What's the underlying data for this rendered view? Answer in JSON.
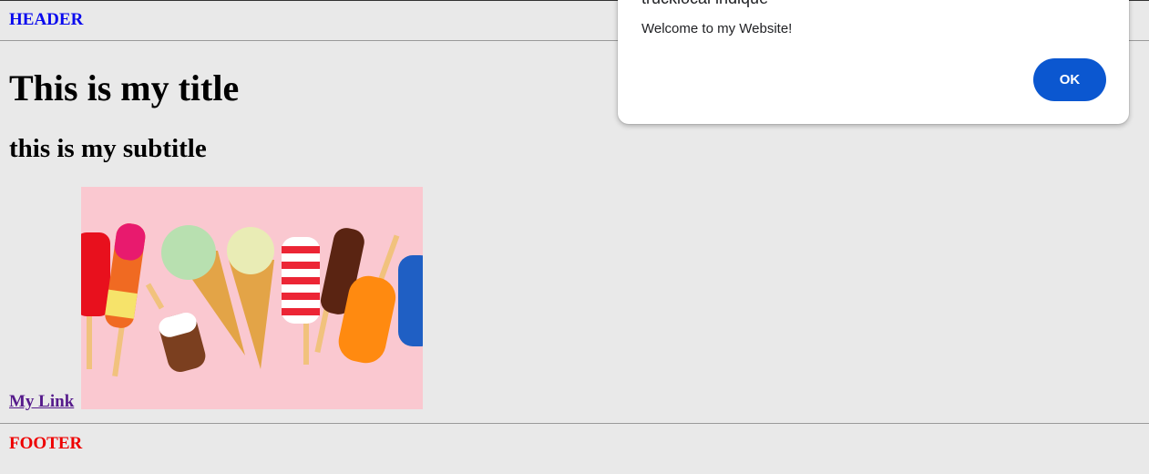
{
  "page": {
    "header": "HEADER",
    "title": "This is my title",
    "subtitle": "this is my subtitle",
    "link_text": "My Link",
    "footer": "FOOTER"
  },
  "dialog": {
    "origin": "truckiocal indique",
    "message": "Welcome to my Website!",
    "ok_label": "OK"
  },
  "image": {
    "subject": "ice-creams-and-popsicles"
  },
  "colors": {
    "background": "#e9e9e9",
    "header": "#0a0aee",
    "footer": "#ee0000",
    "link": "#551a8b",
    "ok_button": "#0b57d0"
  }
}
